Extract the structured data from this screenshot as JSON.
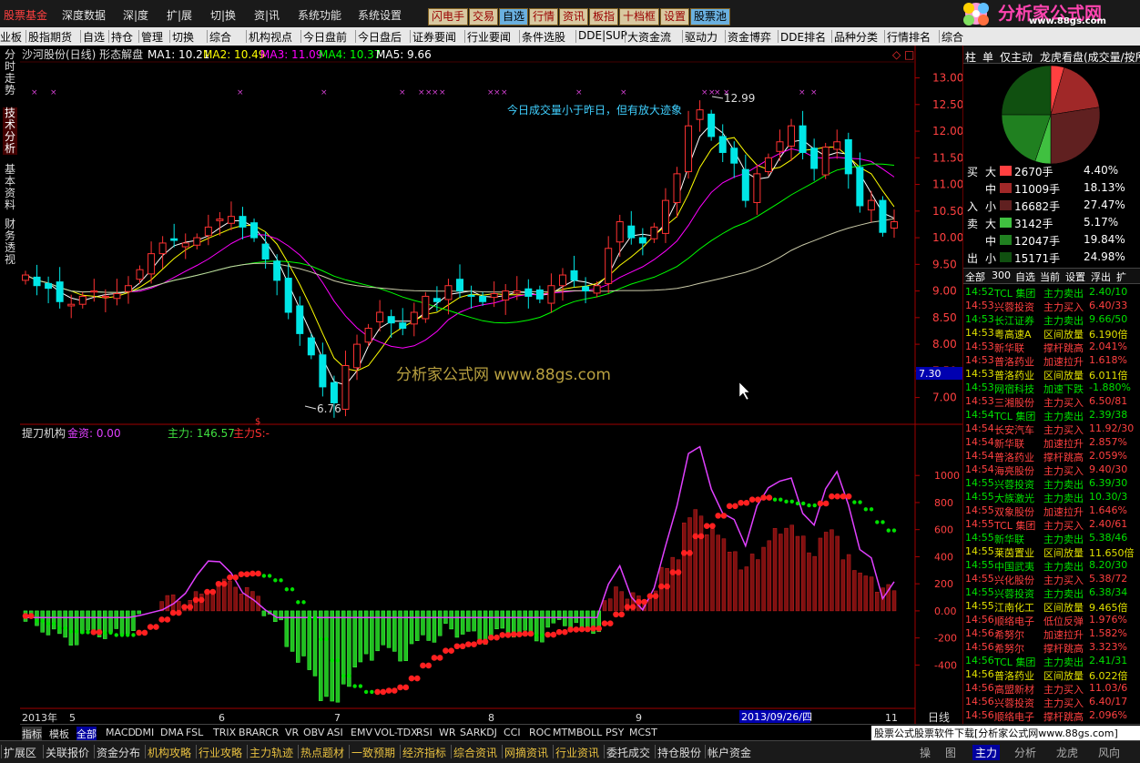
{
  "menu": {
    "items": [
      "股票基金",
      "深度数据",
      "深|度",
      "扩|展",
      "切|换",
      "资|讯",
      "系统功能",
      "系统设置"
    ],
    "quick_buttons": [
      "闪电手",
      "交易",
      "自选",
      "行情",
      "资讯",
      "板指",
      "十档框",
      "设置",
      "股票池"
    ],
    "logo_text": "分析家公式网",
    "logo_url": "www.88gs.com"
  },
  "toolbar2": [
    "业板",
    "股指期货",
    "自选",
    "持仓",
    "管理",
    "切换",
    "综合",
    "机构视点",
    "今日盘前",
    "今日盘后",
    "证券要闻",
    "行业要闻",
    "条件选股",
    "DDE|SUP",
    "大资金流",
    "驱动力",
    "资金博弈",
    "DDE排名",
    "品种分类",
    "行情排名",
    "综合"
  ],
  "left_tabs": [
    "分时走势",
    "技术分析",
    "基本资料",
    "财务透视"
  ],
  "chart": {
    "header": {
      "title": "沙河股份(日线) 形态解盘",
      "ma1": "MA1: 10.21",
      "ma2": "MA2: 10.49",
      "ma3": "MA3: 11.09",
      "ma4": "MA4: 10.37",
      "ma5": "MA5: 9.66"
    },
    "annotation": "今日成交量小于昨日，但有放大迹象",
    "high_label": "12.99",
    "low_label": "6.76",
    "watermark": "分析家公式网  www.88gs.com",
    "current_price": "7.30",
    "price_ticks": [
      "13.00",
      "12.50",
      "12.00",
      "11.50",
      "11.00",
      "10.50",
      "10.00",
      "9.50",
      "9.00",
      "8.50",
      "8.00",
      "7.50",
      "7.00"
    ],
    "indicator_header": {
      "name": "提刀机构",
      "gold": "金资: 0.00",
      "main": "主力: 146.57",
      "main_s": "主力S:-"
    },
    "ind_ticks": [
      "1000",
      "800",
      "600",
      "400",
      "200",
      "0.00",
      "-200",
      "-400"
    ],
    "x_labels": [
      "2013年",
      "5",
      "6",
      "7",
      "8",
      "9",
      "11"
    ],
    "date_box": "2013/09/26/四",
    "period": "日线",
    "colors": {
      "up": "#ff3232",
      "down": "#00e6e6",
      "ma1": "#ffffff",
      "ma2": "#ffff00",
      "ma3": "#ff00ff",
      "ma4": "#00ff00",
      "ma5": "#ffffff",
      "red_dot": "#ff2020",
      "green_dot": "#00e000",
      "magenta": "#e040ff"
    }
  },
  "chart_data": {
    "type": "candlestick",
    "title": "沙河股份(日线) 形态解盘",
    "ylim": [
      6.6,
      13.3
    ],
    "indicator_ylim": [
      -700,
      1230
    ],
    "series": [
      {
        "name": "MA1",
        "value": 10.21
      },
      {
        "name": "MA2",
        "value": 10.49
      },
      {
        "name": "MA3",
        "value": 11.09
      },
      {
        "name": "MA4",
        "value": 10.37
      },
      {
        "name": "MA5",
        "value": 9.66
      }
    ],
    "close_path": [
      9.3,
      9.1,
      9.05,
      8.8,
      8.75,
      8.9,
      9.0,
      8.9,
      8.95,
      9.1,
      9.4,
      9.7,
      9.9,
      9.95,
      9.9,
      10.0,
      10.2,
      10.35,
      10.4,
      10.2,
      10.0,
      9.6,
      9.2,
      8.6,
      8.2,
      7.8,
      7.2,
      6.9,
      7.6,
      8.0,
      8.3,
      8.6,
      8.4,
      8.3,
      8.6,
      8.9,
      8.8,
      9.1,
      9.0,
      8.9,
      8.8,
      8.95,
      9.0,
      9.0,
      8.9,
      8.85,
      9.1,
      9.3,
      9.2,
      9.0,
      9.1,
      9.8,
      10.3,
      10.0,
      9.9,
      10.2,
      10.7,
      11.2,
      12.1,
      12.4,
      11.9,
      11.6,
      11.4,
      10.7,
      11.2,
      11.5,
      11.8,
      12.1,
      11.6,
      11.3,
      11.7,
      11.8,
      11.2,
      10.6,
      10.7,
      10.1,
      10.3
    ]
  },
  "right_panel": {
    "tabs": [
      "柱",
      "单",
      "仅主动",
      "龙虎看盘(成交量/按所"
    ],
    "flow": [
      {
        "side": "买",
        "size": "大",
        "amount": "2670手",
        "pct": "4.40%",
        "color": "#ff4040"
      },
      {
        "side": "",
        "size": "中",
        "amount": "11009手",
        "pct": "18.13%",
        "color": "#a02828"
      },
      {
        "side": "入",
        "size": "小",
        "amount": "16682手",
        "pct": "27.47%",
        "color": "#602020"
      },
      {
        "side": "卖",
        "size": "大",
        "amount": "3142手",
        "pct": "5.17%",
        "color": "#40c040"
      },
      {
        "side": "",
        "size": "中",
        "amount": "12047手",
        "pct": "19.84%",
        "color": "#208020"
      },
      {
        "side": "出",
        "size": "小",
        "amount": "15171手",
        "pct": "24.98%",
        "color": "#105010"
      }
    ],
    "pie_data": [
      {
        "label": "买大",
        "value": 4.4
      },
      {
        "label": "买中",
        "value": 18.13
      },
      {
        "label": "买小",
        "value": 27.47
      },
      {
        "label": "卖大",
        "value": 5.17
      },
      {
        "label": "卖中",
        "value": 19.84
      },
      {
        "label": "卖小",
        "value": 24.98
      }
    ],
    "list_tabs": [
      "全部",
      "300",
      "自选",
      "当前",
      "设置",
      "浮出",
      "扩"
    ],
    "ticks": [
      {
        "time": "14:52",
        "name": "TCL 集团",
        "action": "主力卖出",
        "val": "2.40/10",
        "c": "#00e000"
      },
      {
        "time": "14:53",
        "name": "兴蓉投资",
        "action": "主力买入",
        "val": "6.40/33",
        "c": "#ff4040"
      },
      {
        "time": "14:53",
        "name": "长江证券",
        "action": "主力卖出",
        "val": "9.66/50",
        "c": "#00e000"
      },
      {
        "time": "14:53",
        "name": "粤高速A",
        "action": "区间放量",
        "val": "6.190倍",
        "c": "#e0e000"
      },
      {
        "time": "14:53",
        "name": "新华联",
        "action": "撑杆跳高",
        "val": "2.041%",
        "c": "#ff4040"
      },
      {
        "time": "14:53",
        "name": "普洛药业",
        "action": "加速拉升",
        "val": "1.618%",
        "c": "#ff4040"
      },
      {
        "time": "14:53",
        "name": "普洛药业",
        "action": "区间放量",
        "val": "6.011倍",
        "c": "#e0e000"
      },
      {
        "time": "14:53",
        "name": "网宿科技",
        "action": "加速下跌",
        "val": "-1.880%",
        "c": "#00e000"
      },
      {
        "time": "14:53",
        "name": "三湘股份",
        "action": "主力买入",
        "val": "6.50/81",
        "c": "#ff4040"
      },
      {
        "time": "14:54",
        "name": "TCL 集团",
        "action": "主力卖出",
        "val": "2.39/38",
        "c": "#00e000"
      },
      {
        "time": "14:54",
        "name": "长安汽车",
        "action": "主力买入",
        "val": "11.92/30",
        "c": "#ff4040"
      },
      {
        "time": "14:54",
        "name": "新华联",
        "action": "加速拉升",
        "val": "2.857%",
        "c": "#ff4040"
      },
      {
        "time": "14:54",
        "name": "普洛药业",
        "action": "撑杆跳高",
        "val": "2.059%",
        "c": "#ff4040"
      },
      {
        "time": "14:54",
        "name": "海亮股份",
        "action": "主力买入",
        "val": "9.40/30",
        "c": "#ff4040"
      },
      {
        "time": "14:55",
        "name": "兴蓉投资",
        "action": "主力卖出",
        "val": "6.39/30",
        "c": "#00e000"
      },
      {
        "time": "14:55",
        "name": "大族激光",
        "action": "主力卖出",
        "val": "10.30/3",
        "c": "#00e000"
      },
      {
        "time": "14:55",
        "name": "双象股份",
        "action": "加速拉升",
        "val": "1.646%",
        "c": "#ff4040"
      },
      {
        "time": "14:55",
        "name": "TCL 集团",
        "action": "主力买入",
        "val": "2.40/61",
        "c": "#ff4040"
      },
      {
        "time": "14:55",
        "name": "新华联",
        "action": "主力卖出",
        "val": "5.38/46",
        "c": "#00e000"
      },
      {
        "time": "14:55",
        "name": "莱茵置业",
        "action": "区间放量",
        "val": "11.650倍",
        "c": "#e0e000"
      },
      {
        "time": "14:55",
        "name": "中国武夷",
        "action": "主力卖出",
        "val": "8.20/30",
        "c": "#00e000"
      },
      {
        "time": "14:55",
        "name": "兴化股份",
        "action": "主力买入",
        "val": "5.38/72",
        "c": "#ff4040"
      },
      {
        "time": "14:55",
        "name": "兴蓉投资",
        "action": "主力卖出",
        "val": "6.38/34",
        "c": "#00e000"
      },
      {
        "time": "14:55",
        "name": "江南化工",
        "action": "区间放量",
        "val": "9.465倍",
        "c": "#e0e000"
      },
      {
        "time": "14:56",
        "name": "顺络电子",
        "action": "低位反弹",
        "val": "1.976%",
        "c": "#ff4040"
      },
      {
        "time": "14:56",
        "name": "希努尔",
        "action": "加速拉升",
        "val": "1.582%",
        "c": "#ff4040"
      },
      {
        "time": "14:56",
        "name": "希努尔",
        "action": "撑杆跳高",
        "val": "3.323%",
        "c": "#ff4040"
      },
      {
        "time": "14:56",
        "name": "TCL 集团",
        "action": "主力卖出",
        "val": "2.41/31",
        "c": "#00e000"
      },
      {
        "time": "14:56",
        "name": "普洛药业",
        "action": "区间放量",
        "val": "6.022倍",
        "c": "#e0e000"
      },
      {
        "time": "14:56",
        "name": "高盟新材",
        "action": "主力买入",
        "val": "11.03/6",
        "c": "#ff4040"
      },
      {
        "time": "14:56",
        "name": "兴蓉投资",
        "action": "主力买入",
        "val": "6.40/17",
        "c": "#ff4040"
      },
      {
        "time": "14:56",
        "name": "顺络电子",
        "action": "撑杆跳高",
        "val": "2.096%",
        "c": "#ff4040"
      }
    ],
    "bottom_tabs": [
      "操",
      "图",
      "主力",
      "分析",
      "龙虎",
      "风向"
    ]
  },
  "indicator_tabs": [
    "指标",
    "模板",
    "全部",
    "MACD",
    "DMI",
    "DMA",
    "FSL",
    "TRIX",
    "BRAR",
    "CR",
    "VR",
    "OBV",
    "ASI",
    "EMV",
    "VOL-TDX",
    "RSI",
    "WR",
    "SAR",
    "KDJ",
    "CCI",
    "ROC",
    "MTM",
    "BOLL",
    "PSY",
    "MCST"
  ],
  "credit": "股票公式股票软件下载[分析家公式网www.88gs.com]",
  "bottom_bar": [
    "扩展区",
    "关联报价",
    "资金分布",
    "机构攻略",
    "行业攻略",
    "主力轨迹",
    "热点题材",
    "一致预期",
    "经济指标",
    "综合资讯",
    "网摘资讯",
    "行业资讯",
    "委托成交",
    "持仓股份",
    "帐户资金"
  ]
}
